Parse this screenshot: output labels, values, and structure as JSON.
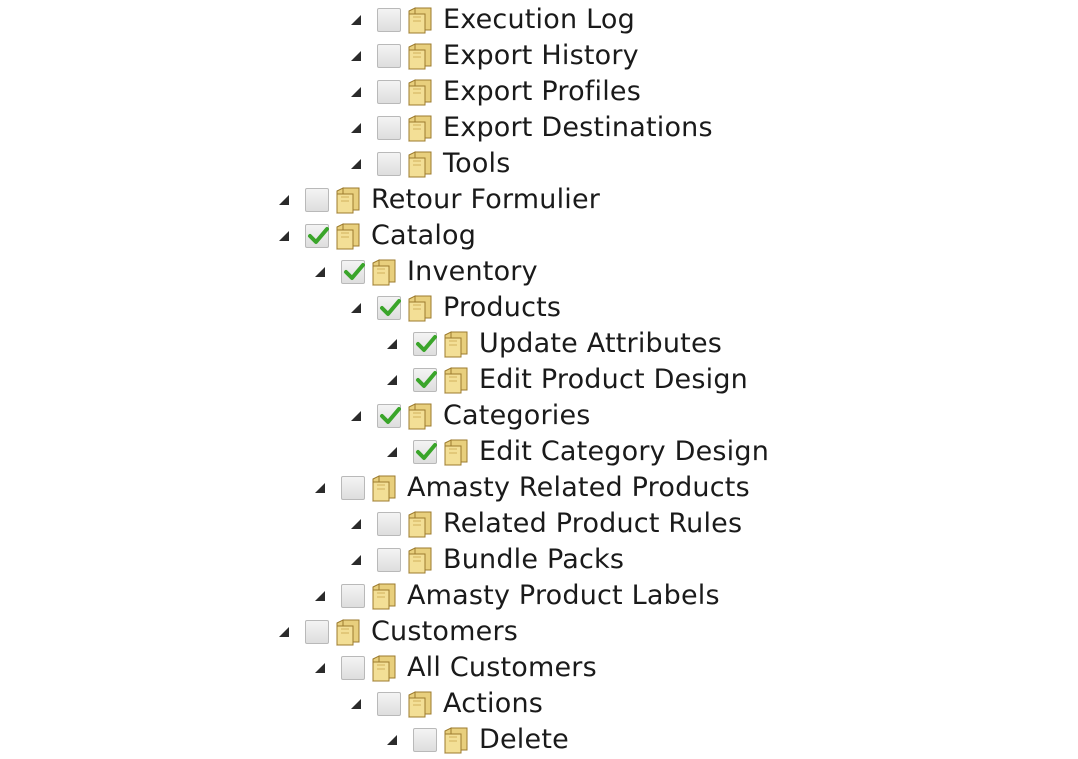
{
  "tree": {
    "nodes": [
      {
        "label": "Execution Log",
        "checked": false
      },
      {
        "label": "Export History",
        "checked": false
      },
      {
        "label": "Export Profiles",
        "checked": false
      },
      {
        "label": "Export Destinations",
        "checked": false
      },
      {
        "label": "Tools",
        "checked": false
      },
      {
        "label": "Retour Formulier",
        "checked": false
      },
      {
        "label": "Catalog",
        "checked": true
      },
      {
        "label": "Inventory",
        "checked": true
      },
      {
        "label": "Products",
        "checked": true
      },
      {
        "label": "Update Attributes",
        "checked": true
      },
      {
        "label": "Edit Product Design",
        "checked": true
      },
      {
        "label": "Categories",
        "checked": true
      },
      {
        "label": "Edit Category Design",
        "checked": true
      },
      {
        "label": "Amasty Related Products",
        "checked": false
      },
      {
        "label": "Related Product Rules",
        "checked": false
      },
      {
        "label": "Bundle Packs",
        "checked": false
      },
      {
        "label": "Amasty Product Labels",
        "checked": false
      },
      {
        "label": "Customers",
        "checked": false
      },
      {
        "label": "All Customers",
        "checked": false
      },
      {
        "label": "Actions",
        "checked": false
      },
      {
        "label": "Delete",
        "checked": false
      }
    ]
  },
  "icons": {
    "expand_toggle": "expanded-triangle-icon",
    "folder": "folder-icon",
    "check": "checkmark-icon"
  },
  "colors": {
    "check_green": "#3aa52a",
    "folder_fill": "#e8cf7d",
    "folder_stroke": "#9c7b2e"
  }
}
